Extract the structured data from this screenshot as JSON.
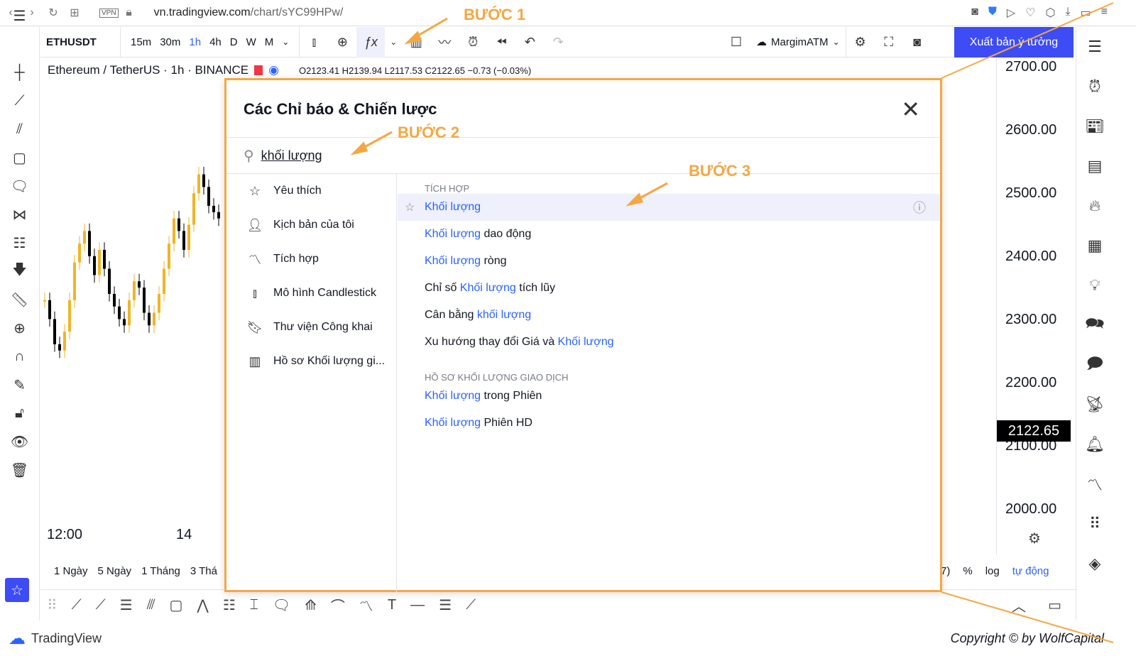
{
  "browser": {
    "url_host": "vn.tradingview.com",
    "url_path": "/chart/sYC99HPw/",
    "vpn": "VPN"
  },
  "toolbar": {
    "symbol": "ETHUSDT",
    "timeframes": [
      "15m",
      "30m",
      "1h",
      "4h",
      "D",
      "W",
      "M"
    ],
    "active_timeframe": "1h",
    "layout_name": "MargimATM",
    "publish": "Xuất bản ý tưởng"
  },
  "legend": {
    "title": "Ethereum / TetherUS · 1h · BINANCE",
    "ohlc": "O2123.41  H2139.94  L2117.53  C2122.65  −0.73 (−0.03%)"
  },
  "price_axis": {
    "ticks": [
      "2700.00",
      "2600.00",
      "2500.00",
      "2400.00",
      "2300.00",
      "2200.00",
      "2100.00",
      "2000.00"
    ],
    "current": "2122.65"
  },
  "time_axis": [
    "12:00",
    "14"
  ],
  "ranges": [
    "1 Ngày",
    "5 Ngày",
    "1 Tháng",
    "3 Thá"
  ],
  "scale_opts": [
    "7)",
    "%",
    "log",
    "tự động"
  ],
  "candles_close": [
    2330,
    2300,
    2260,
    2250,
    2280,
    2330,
    2390,
    2420,
    2440,
    2400,
    2370,
    2410,
    2380,
    2340,
    2320,
    2300,
    2290,
    2330,
    2360,
    2350,
    2310,
    2290,
    2310,
    2340,
    2380,
    2420,
    2460,
    2440,
    2410,
    2450,
    2500,
    2530,
    2510,
    2480,
    2470,
    2460
  ],
  "modal": {
    "title": "Các Chỉ báo & Chiến lược",
    "search_value": "khối lượng",
    "categories": [
      {
        "icon": "star-icon",
        "label": "Yêu thích"
      },
      {
        "icon": "user-icon",
        "label": "Kịch bản của tôi"
      },
      {
        "icon": "chart-icon",
        "label": "Tích hợp"
      },
      {
        "icon": "candlestick-icon",
        "label": "Mô hình Candlestick"
      },
      {
        "icon": "bookmark-icon",
        "label": "Thư viện Công khai"
      },
      {
        "icon": "bars-icon",
        "label": "Hồ sơ Khối lượng gi..."
      }
    ],
    "section1": "TÍCH HỢP",
    "results1": [
      {
        "pre": "",
        "hl": "Khối lượng",
        "post": ""
      },
      {
        "pre": "",
        "hl": "Khối lượng",
        "post": " dao động"
      },
      {
        "pre": "",
        "hl": "Khối lượng",
        "post": " ròng"
      },
      {
        "pre": "Chỉ số ",
        "hl": "Khối lượng",
        "post": " tích lũy"
      },
      {
        "pre": "Cân bằng ",
        "hl": "khối lượng",
        "post": ""
      },
      {
        "pre": "Xu hướng thay đổi Giá và ",
        "hl": "Khối lượng",
        "post": ""
      }
    ],
    "section2": "HỒ SƠ KHỐI LƯỢNG GIAO DỊCH",
    "results2": [
      {
        "pre": "",
        "hl": "Khối lượng",
        "post": " trong Phiên"
      },
      {
        "pre": "",
        "hl": "Khối lượng",
        "post": " Phiên HD"
      }
    ]
  },
  "annotations": [
    "BƯỚC 1",
    "BƯỚC 2",
    "BƯỚC 3"
  ],
  "footer": {
    "brand": "TradingView",
    "copyright": "Copyright © by WolfCapital"
  },
  "colors": {
    "accent": "#2962ff",
    "publish": "#3d4cf5",
    "annotation": "#f5a742",
    "up": "#f0b429",
    "down": "#000000"
  }
}
